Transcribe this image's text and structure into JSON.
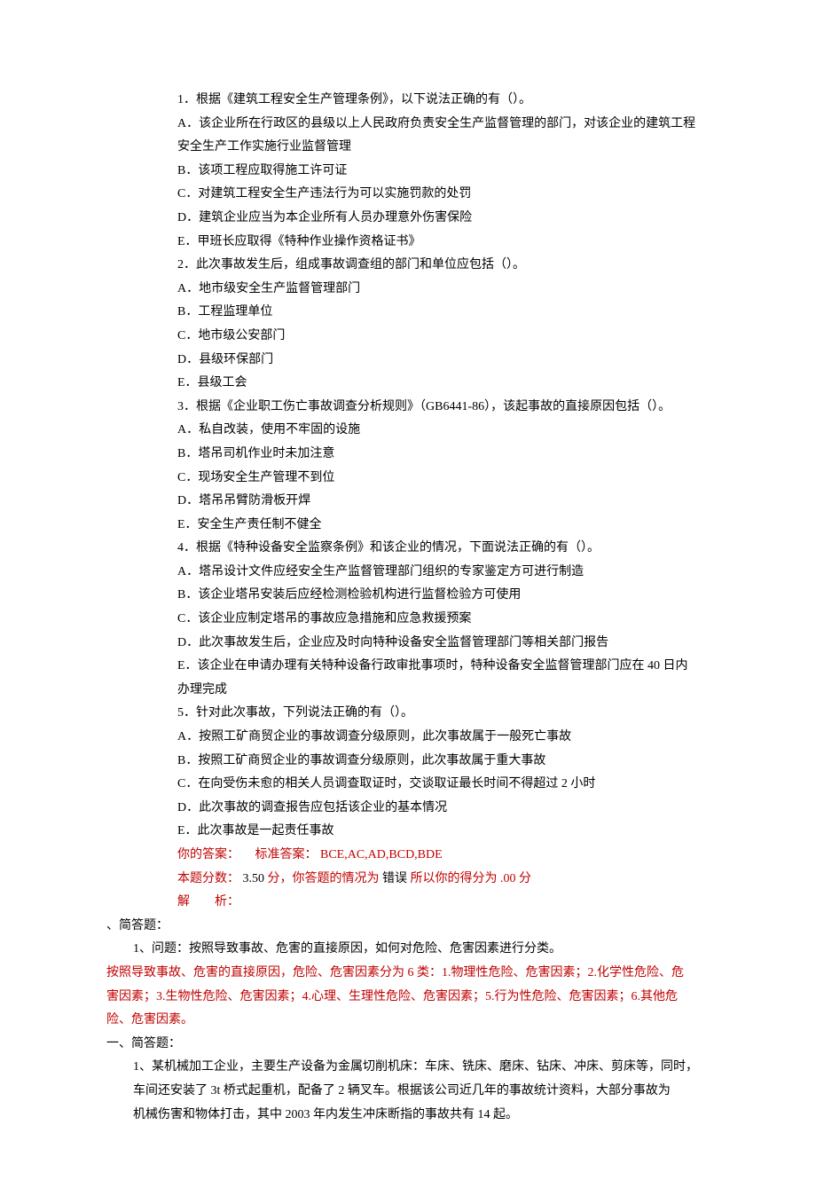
{
  "q1": {
    "stem": "1．根据《建筑工程安全生产管理条例》，以下说法正确的有（）。",
    "A1": "A．该企业所在行政区的县级以上人民政府负责安全生产监督管理的部门，对该企业的建筑工程",
    "A2": "安全生产工作实施行业监督管理",
    "B": "B．该项工程应取得施工许可证",
    "C": "C．对建筑工程安全生产违法行为可以实施罚款的处罚",
    "D": "D．建筑企业应当为本企业所有人员办理意外伤害保险",
    "E": "E．甲班长应取得《特种作业操作资格证书》"
  },
  "q2": {
    "stem": "2．此次事故发生后，组成事故调查组的部门和单位应包括（）。",
    "A": "A．地市级安全生产监督管理部门",
    "B": "B．工程监理单位",
    "C": "C．地市级公安部门",
    "D": "D．县级环保部门",
    "E": "E．县级工会"
  },
  "q3": {
    "stem": "3．根据《企业职工伤亡事故调查分析规则》（GB6441-86），该起事故的直接原因包括（）。",
    "A": "A．私自改装，使用不牢固的设施",
    "B": "B．塔吊司机作业时未加注意",
    "C": "C．现场安全生产管理不到位",
    "D": "D．塔吊吊臂防滑板开焊",
    "E": "E．安全生产责任制不健全"
  },
  "q4": {
    "stem": "4．根据《特种设备安全监察条例》和该企业的情况，下面说法正确的有（）。",
    "A": "A．塔吊设计文件应经安全生产监督管理部门组织的专家鉴定方可进行制造",
    "B": "B．该企业塔吊安装后应经检测检验机构进行监督检验方可使用",
    "C": "C．该企业应制定塔吊的事故应急措施和应急救援预案",
    "D": "D．此次事故发生后，企业应及时向特种设备安全监督管理部门等相关部门报告",
    "E1": "E．该企业在申请办理有关特种设备行政审批事项时，特种设备安全监督管理部门应在 40 日内",
    "E2": "办理完成"
  },
  "q5": {
    "stem": "5．针对此次事故，下列说法正确的有（）。",
    "A": "A．按照工矿商贸企业的事故调查分级原则，此次事故属于一般死亡事故",
    "B": "B．按照工矿商贸企业的事故调查分级原则，此次事故属于重大事故",
    "C": "C．在向受伤未愈的相关人员调查取证时，交谈取证最长时间不得超过 2 小时",
    "D": "D．此次事故的调查报告应包括该企业的基本情况",
    "E": "E．此次事故是一起责任事故"
  },
  "ans": {
    "your_label": "你的答案：",
    "std_label": "标准答案：",
    "std_value": "BCE,AC,AD,BCD,BDE",
    "score_line_a": "本题分数：",
    "score_val": " 3.50 ",
    "score_line_b": "分，你答题的情况为",
    "wrong": " 错误 ",
    "score_line_c": "所以你的得分为",
    "got": " .00 分",
    "jiexi_label": "解　　析："
  },
  "short1": {
    "header": "、简答题：",
    "q": "1、问题：按照导致事故、危害的直接原因，如何对危险、危害因素进行分类。",
    "a1": "按照导致事故、危害的直接原因，危险、危害因素分为 6 类：1.物理性危险、危害因素；2.化学性危险、危",
    "a2": "害因素；3.生物性危险、危害因素；4.心理、生理性危险、危害因素；5.行为性危险、危害因素；6.其他危",
    "a3": "险、危害因素。"
  },
  "short2": {
    "header": "一、简答题：",
    "l1": "1、某机械加工企业，主要生产设备为金属切削机床：车床、铣床、磨床、钻床、冲床、剪床等，同时，",
    "l2": "车间还安装了 3t 桥式起重机，配备了 2 辆叉车。根据该公司近几年的事故统计资料，大部分事故为",
    "l3": "机械伤害和物体打击，其中 2003 年内发生冲床断指的事故共有 14 起。"
  }
}
